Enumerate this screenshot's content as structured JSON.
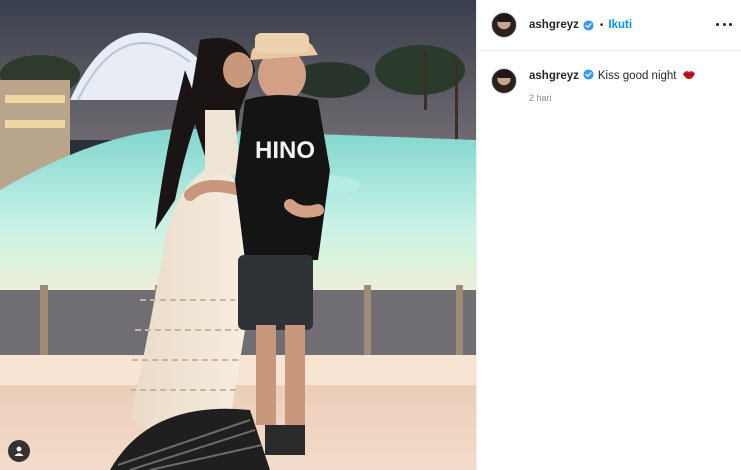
{
  "post": {
    "author": {
      "username": "ashgreyz",
      "verified": true
    },
    "follow_label": "Ikuti",
    "separator": "•",
    "caption": {
      "text": "Kiss good night",
      "emoji": "lips-kiss-icon"
    },
    "time_ago": "2 hari"
  },
  "photo": {
    "description_icon": "tagged-user-icon"
  },
  "colors": {
    "follow_blue": "#0095f6",
    "text": "#262626",
    "muted": "#8e8e8e",
    "verified_blue": "#3897f0",
    "divider": "#efefef"
  }
}
